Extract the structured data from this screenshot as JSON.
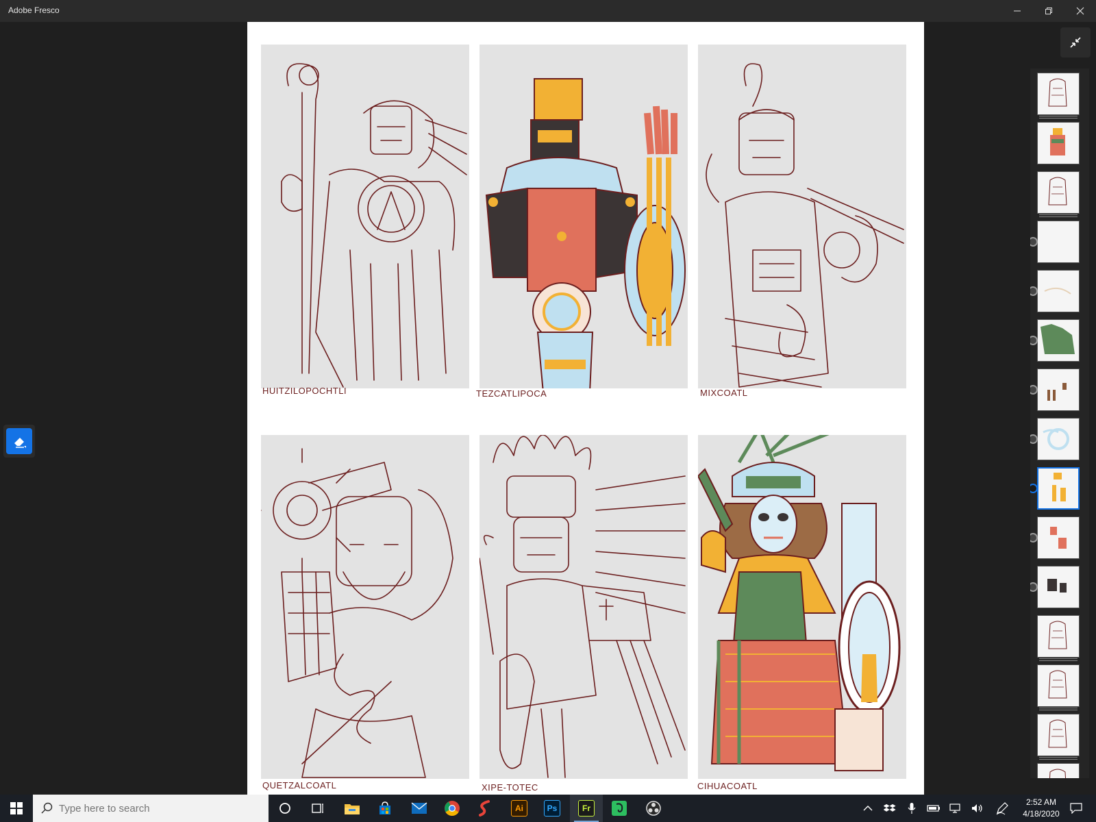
{
  "window": {
    "title": "Adobe Fresco"
  },
  "canvas": {
    "panels": [
      {
        "label": "HUITZILOPOCHTLI"
      },
      {
        "label": "TEZCATLIPOCA"
      },
      {
        "label": "MIXCOATL"
      },
      {
        "label": "QUETZALCOATL"
      },
      {
        "label": "XIPE-TOTEC"
      },
      {
        "label": "CIHUACOATL"
      }
    ]
  },
  "colors": {
    "accent": "#1473e6",
    "lineart": "#6b1e1e",
    "mustard": "#f2b134",
    "salmon": "#e0715c",
    "sky": "#bfe0f0",
    "charcoal": "#3b3434",
    "green": "#5d8a5a"
  },
  "tools": {
    "active_tool_icon": "eraser-icon"
  },
  "layers": {
    "selected_index": 8,
    "items": [
      {
        "thumb": "sketch"
      },
      {
        "thumb": "color"
      },
      {
        "thumb": "sketch"
      },
      {
        "thumb": "blank"
      },
      {
        "thumb": "faint"
      },
      {
        "thumb": "green"
      },
      {
        "thumb": "brown"
      },
      {
        "thumb": "lightblue"
      },
      {
        "thumb": "yellow"
      },
      {
        "thumb": "red"
      },
      {
        "thumb": "black"
      },
      {
        "thumb": "sketch"
      },
      {
        "thumb": "sketch"
      },
      {
        "thumb": "sketch"
      },
      {
        "thumb": "sketch"
      }
    ]
  },
  "taskbar": {
    "search_placeholder": "Type here to search",
    "apps": [
      "file-explorer-icon",
      "store-icon",
      "mail-icon",
      "chrome-icon",
      "app-s-icon",
      "illustrator-icon",
      "photoshop-icon",
      "fresco-icon",
      "evernote-icon",
      "obs-icon"
    ],
    "app_labels": {
      "illustrator": "Ai",
      "photoshop": "Ps",
      "fresco": "Fr"
    },
    "clock": {
      "time": "2:52 AM",
      "date": "4/18/2020"
    }
  }
}
